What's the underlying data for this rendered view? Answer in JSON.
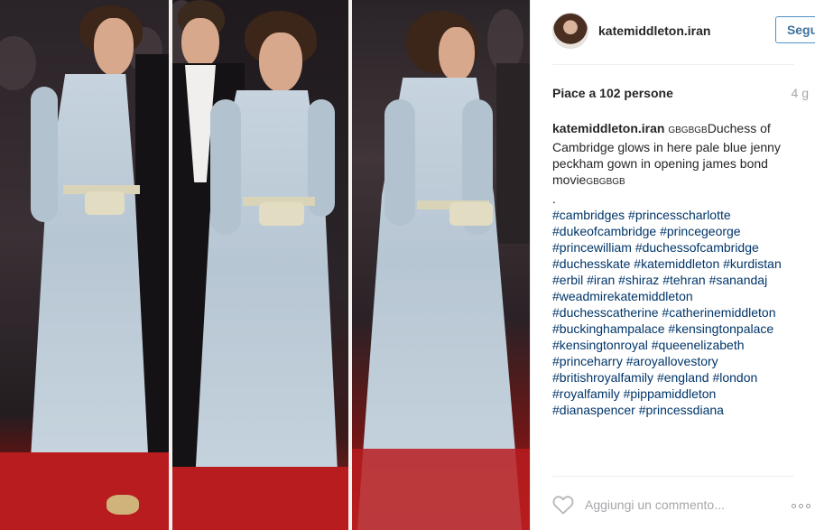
{
  "post": {
    "username": "katemiddleton.iran",
    "follow_label": "Segui",
    "likes_text": "Piace a 102 persone",
    "age": "4 g",
    "caption_username": "katemiddleton.iran",
    "caption_flag_start": "GBGBGB",
    "caption_text": "Duchess of Cambridge glows in here pale blue jenny peckham gown in opening james bond movie",
    "caption_flag_end": "GBGBGB",
    "caption_dot": ".",
    "hashtags": [
      "#cambridges",
      "#princesscharlotte",
      "#dukeofcambridge",
      "#princegeorge",
      "#princewilliam",
      "#duchessofcambridge",
      "#duchesskate",
      "#katemiddleton",
      "#kurdistan",
      "#erbil",
      "#iran",
      "#shiraz",
      "#tehran",
      "#sanandaj",
      "#weadmirekatemiddleton",
      "#duchesscatherine",
      "#catherinemiddleton",
      "#buckinghampalace",
      "#kensingtonpalace",
      "#kensingtonroyal",
      "#queenelizabeth",
      "#princeharry",
      "#aroyallovestory",
      "#britishroyalfamily",
      "#england",
      "#london",
      "#royalfamily",
      "#pippamiddleton",
      "#dianaspencer",
      "#princessdiana"
    ],
    "comment_placeholder": "Aggiungi un commento...",
    "icons": {
      "like": "heart-outline-icon",
      "more": "more-options-icon"
    }
  },
  "colors": {
    "follow_blue": "#3f729b",
    "hashtag": "#003569",
    "muted": "#a5a7aa",
    "text": "#262626"
  }
}
